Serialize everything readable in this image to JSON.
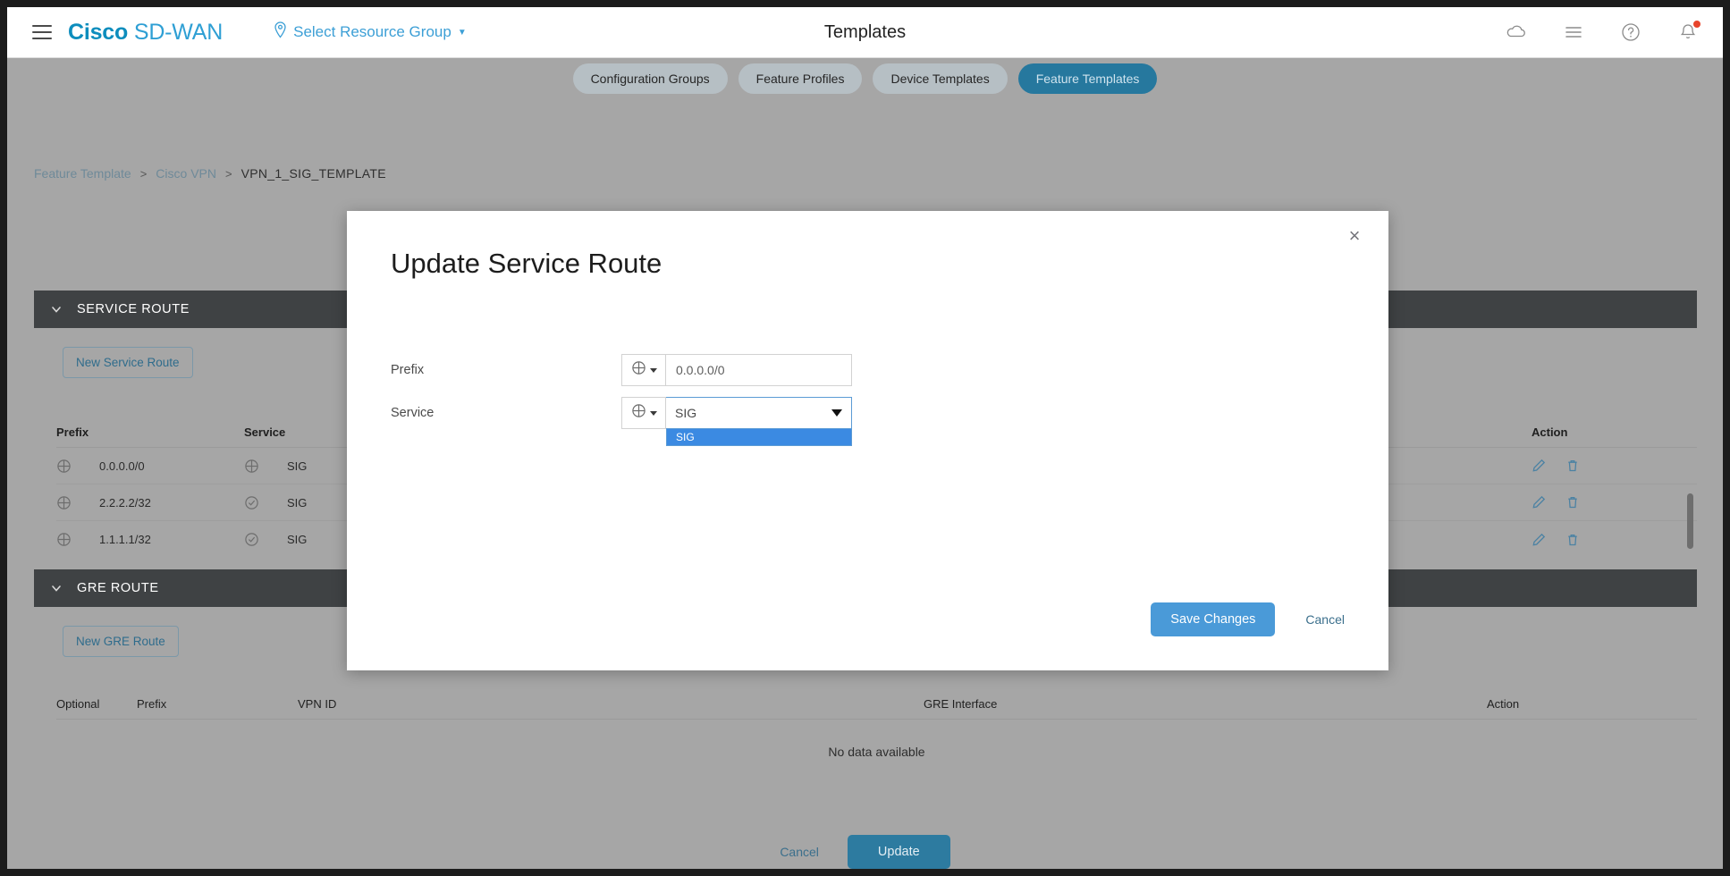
{
  "header": {
    "brand_cisco": "Cisco",
    "brand_product": "SD-WAN",
    "resource_group": "Select Resource Group",
    "page_title": "Templates",
    "icons": [
      "cloud-icon",
      "list-icon",
      "help-icon",
      "notifications-icon"
    ]
  },
  "tabs": [
    {
      "label": "Configuration Groups",
      "active": false
    },
    {
      "label": "Feature Profiles",
      "active": false
    },
    {
      "label": "Device Templates",
      "active": false
    },
    {
      "label": "Feature Templates",
      "active": true
    }
  ],
  "breadcrumb": {
    "items": [
      "Feature Template",
      "Cisco VPN"
    ],
    "current": "VPN_1_SIG_TEMPLATE",
    "separator": ">"
  },
  "service_route": {
    "section_title": "SERVICE ROUTE",
    "new_button": "New Service Route",
    "columns": [
      "Prefix",
      "Service",
      "Action"
    ],
    "rows": [
      {
        "prefix_scope": "globe-icon",
        "prefix": "0.0.0.0/0",
        "service_scope": "globe-icon",
        "service": "SIG"
      },
      {
        "prefix_scope": "globe-icon",
        "prefix": "2.2.2.2/32",
        "service_scope": "check-icon",
        "service": "SIG"
      },
      {
        "prefix_scope": "globe-icon",
        "prefix": "1.1.1.1/32",
        "service_scope": "check-icon",
        "service": "SIG"
      }
    ]
  },
  "gre_route": {
    "section_title": "GRE ROUTE",
    "new_button": "New GRE Route",
    "columns": [
      "Optional",
      "Prefix",
      "VPN ID",
      "GRE Interface",
      "Action"
    ],
    "empty_message": "No data available"
  },
  "footer": {
    "cancel": "Cancel",
    "update": "Update"
  },
  "modal": {
    "title": "Update Service Route",
    "close": "×",
    "fields": {
      "prefix": {
        "label": "Prefix",
        "scope_icon": "globe-icon",
        "value": "0.0.0.0/0"
      },
      "service": {
        "label": "Service",
        "scope_icon": "globe-icon",
        "value": "SIG",
        "options": [
          "SIG"
        ],
        "open": true
      }
    },
    "save": "Save Changes",
    "cancel": "Cancel"
  },
  "colors": {
    "brand_blue": "#00a0d1",
    "tab_active": "#26789e",
    "section_header": "#3f4244",
    "primary_button": "#4a9ad8",
    "update_button": "#2d7ba0",
    "option_highlight": "#3b8ae2",
    "notification_dot": "#e8452c"
  }
}
